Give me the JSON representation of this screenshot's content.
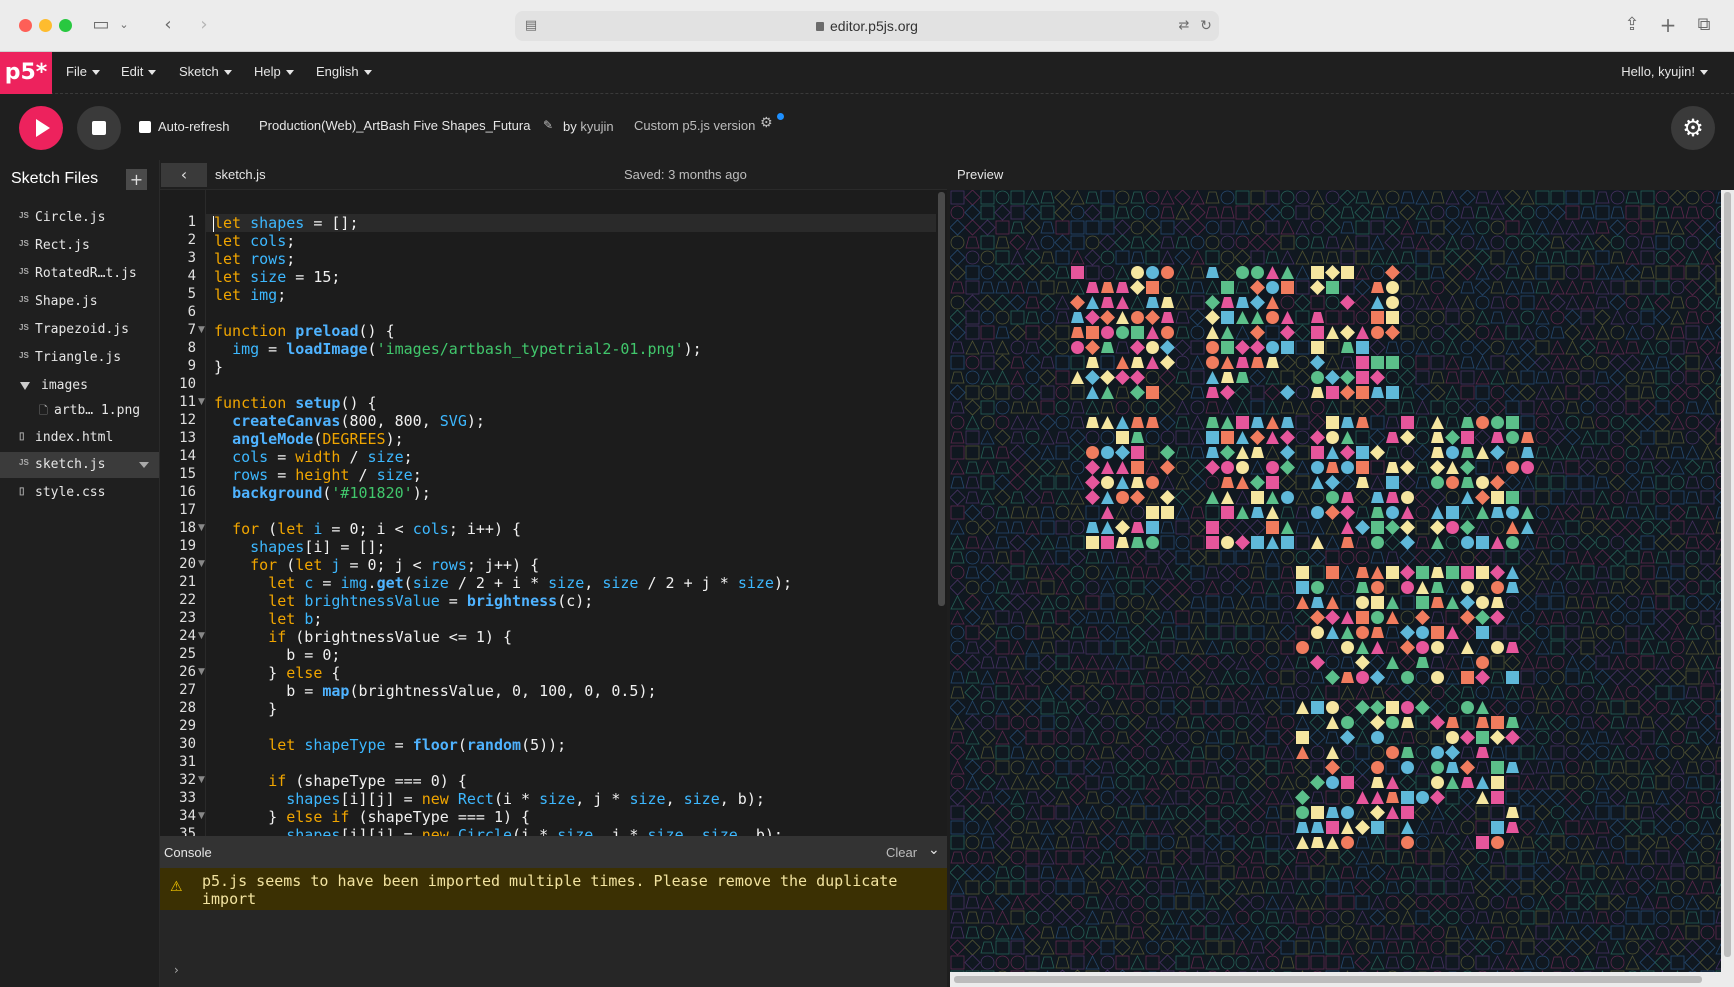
{
  "browser": {
    "url": "editor.p5js.org"
  },
  "menubar": {
    "logo": "p5*",
    "items": [
      {
        "label": "File"
      },
      {
        "label": "Edit"
      },
      {
        "label": "Sketch"
      },
      {
        "label": "Help"
      },
      {
        "label": "English"
      }
    ],
    "user": "Hello, kyujin!"
  },
  "toolbar": {
    "auto_refresh": "Auto-refresh",
    "sketch_name": "Production(Web)_ArtBash Five Shapes_Futura",
    "by": "by",
    "author": "kyujin",
    "custom_version": "Custom p5.js version"
  },
  "sidebar": {
    "title": "Sketch Files",
    "files": [
      {
        "icon": "JS",
        "name": "Circle.js"
      },
      {
        "icon": "JS",
        "name": "Rect.js"
      },
      {
        "icon": "JS",
        "name": "RotatedR…t.js"
      },
      {
        "icon": "JS",
        "name": "Shape.js"
      },
      {
        "icon": "JS",
        "name": "Trapezoid.js"
      },
      {
        "icon": "JS",
        "name": "Triangle.js"
      }
    ],
    "folder": "images",
    "folder_file": "artb… 1.png",
    "files_after": [
      {
        "icon": "▯",
        "name": "index.html"
      },
      {
        "icon": "JS",
        "name": "sketch.js"
      },
      {
        "icon": "▯",
        "name": "style.css"
      }
    ]
  },
  "editor": {
    "tab": "sketch.js",
    "saved": "Saved: 3 months ago",
    "line_numbers": [
      "1",
      "2",
      "3",
      "4",
      "5",
      "6",
      "7",
      "8",
      "9",
      "10",
      "11",
      "12",
      "13",
      "14",
      "15",
      "16",
      "17",
      "18",
      "19",
      "20",
      "21",
      "22",
      "23",
      "24",
      "25",
      "26",
      "27",
      "28",
      "29",
      "30",
      "31",
      "32",
      "33",
      "34",
      "35"
    ]
  },
  "console": {
    "title": "Console",
    "clear": "Clear",
    "warning": "p5.js seems to have been imported multiple times. Please remove the duplicate import"
  },
  "preview": {
    "title": "Preview"
  },
  "colors": {
    "p5_pink": "#ed225d",
    "canvas_bg": "#101820"
  }
}
